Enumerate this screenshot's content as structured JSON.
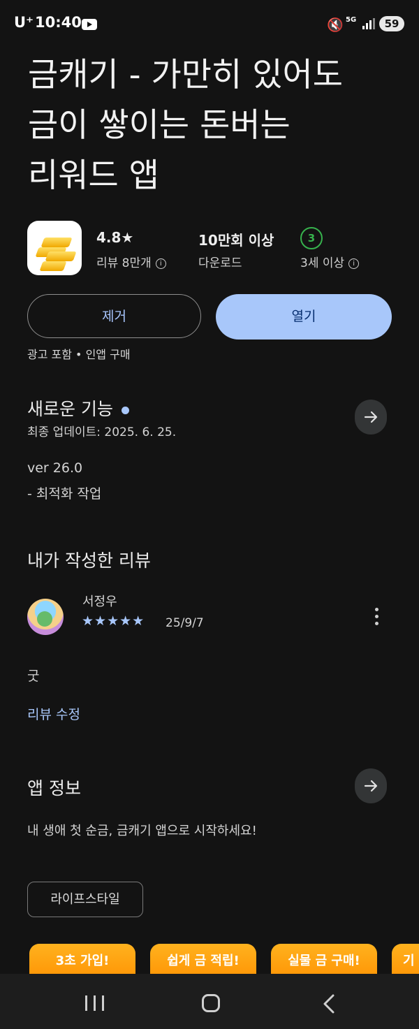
{
  "status_bar": {
    "carrier": "U⁺",
    "time": "10:40",
    "network": "5G",
    "battery": "59"
  },
  "app": {
    "title_lines": [
      "금캐기 - 가만히 있어도",
      "금이 쌓이는 돈버는",
      "리워드 앱"
    ],
    "rating": "4.8★",
    "reviews_label": "리뷰 8만개",
    "downloads": "10만회 이상",
    "downloads_label": "다운로드",
    "content_rating_badge": "3",
    "content_rating_label": "3세 이상"
  },
  "actions": {
    "remove_label": "제거",
    "open_label": "열기"
  },
  "tags": "광고 포함 • 인앱 구매",
  "whats_new": {
    "heading": "새로운 기능",
    "updated": "최종 업데이트: 2025. 6. 25.",
    "version": "ver 26.0",
    "note": "- 최적화 작업"
  },
  "my_review": {
    "heading": "내가 작성한 리뷰",
    "reviewer": "서정우",
    "stars": "★★★★★",
    "rating_value": 5,
    "date": "25/9/7",
    "text": "굿",
    "edit_label": "리뷰 수정"
  },
  "about": {
    "heading": "앱 정보",
    "description": "내 생애 첫 순금, 금캐기 앱으로 시작하세요!",
    "category_chip": "라이프스타일"
  },
  "screenshots": [
    "3초 가입!",
    "쉽게 금 적립!",
    "실물 금 구매!",
    "기회"
  ],
  "colors": {
    "background": "#131313",
    "accent": "#a8c7fa",
    "badge_green": "#37b24d",
    "screenshot_orange": "#ff9f0a"
  }
}
